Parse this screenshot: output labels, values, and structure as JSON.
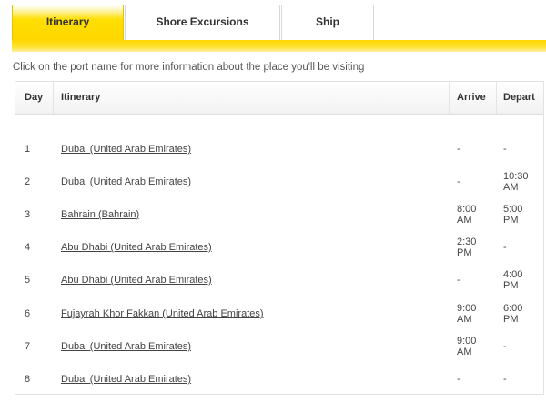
{
  "tabs": [
    {
      "label": "Itinerary",
      "active": true
    },
    {
      "label": "Shore Excursions",
      "active": false
    },
    {
      "label": "Ship",
      "active": false
    }
  ],
  "intro_text": "Click on the port name for more information about the place you'll be visiting",
  "table": {
    "headers": {
      "day": "Day",
      "itinerary": "Itinerary",
      "arrive": "Arrive",
      "depart": "Depart"
    },
    "rows": [
      {
        "day": "1",
        "port": "Dubai (United Arab Emirates)",
        "arrive": [
          "-"
        ],
        "depart": [
          "-"
        ]
      },
      {
        "day": "2",
        "port": "Dubai (United Arab Emirates)",
        "arrive": [
          "-"
        ],
        "depart": [
          "10:30",
          "AM"
        ]
      },
      {
        "day": "3",
        "port": "Bahrain (Bahrain)",
        "arrive": [
          "8:00",
          "AM"
        ],
        "depart": [
          "5:00",
          "PM"
        ]
      },
      {
        "day": "4",
        "port": "Abu Dhabi (United Arab Emirates)",
        "arrive": [
          "2:30",
          "PM"
        ],
        "depart": [
          "-"
        ]
      },
      {
        "day": "5",
        "port": "Abu Dhabi (United Arab Emirates)",
        "arrive": [
          "-"
        ],
        "depart": [
          "4:00",
          "PM"
        ]
      },
      {
        "day": "6",
        "port": "Fujayrah Khor Fakkan (United Arab Emirates)",
        "arrive": [
          "9:00",
          "AM"
        ],
        "depart": [
          "6:00",
          "PM"
        ]
      },
      {
        "day": "7",
        "port": "Dubai (United Arab Emirates)",
        "arrive": [
          "9:00",
          "AM"
        ],
        "depart": [
          "-"
        ]
      },
      {
        "day": "8",
        "port": "Dubai (United Arab Emirates)",
        "arrive": [
          "-"
        ],
        "depart": [
          "-"
        ]
      }
    ]
  },
  "colors": {
    "accent": "#ffd700",
    "text": "#333333"
  }
}
